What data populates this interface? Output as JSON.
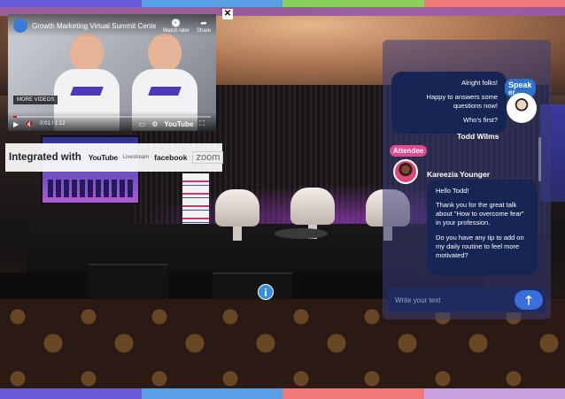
{
  "colors": {
    "top_bar": [
      "#6a5cd8",
      "#5aa0e6",
      "#8ad05a",
      "#f07878"
    ],
    "bottom_bar": [
      "#6a5cd8",
      "#5aa0e6",
      "#f07878",
      "#c9a0e0"
    ]
  },
  "video": {
    "title": "Growth Marketing Virtual Summit Cente...",
    "watch_later": "Watch later",
    "share": "Share",
    "more_videos": "MORE VIDEOS",
    "time": "0:01 / 1:12",
    "progress": 0.02,
    "platform": "YouTube"
  },
  "integrated": {
    "label": "Integrated with",
    "brands": [
      "YouTube",
      "Livestream",
      "facebook",
      "zoom"
    ]
  },
  "chat": {
    "speaker_label": "Speak",
    "speaker_label_cont": "er",
    "speaker_message": [
      "Alright folks!",
      "Happy to answers some questions now!",
      "Who's first?"
    ],
    "speaker_name": "Todd Wilms",
    "attendee_label": "Attendee",
    "attendee_name": "Kareezia Younger",
    "attendee_message": [
      "Hello Todd!",
      "Thank you for the great talk about \"How to overcome fear\" in your profession.",
      "Do you have any tip to add on my daily routine to feel more motivated?"
    ],
    "input_placeholder": "Write your text"
  }
}
